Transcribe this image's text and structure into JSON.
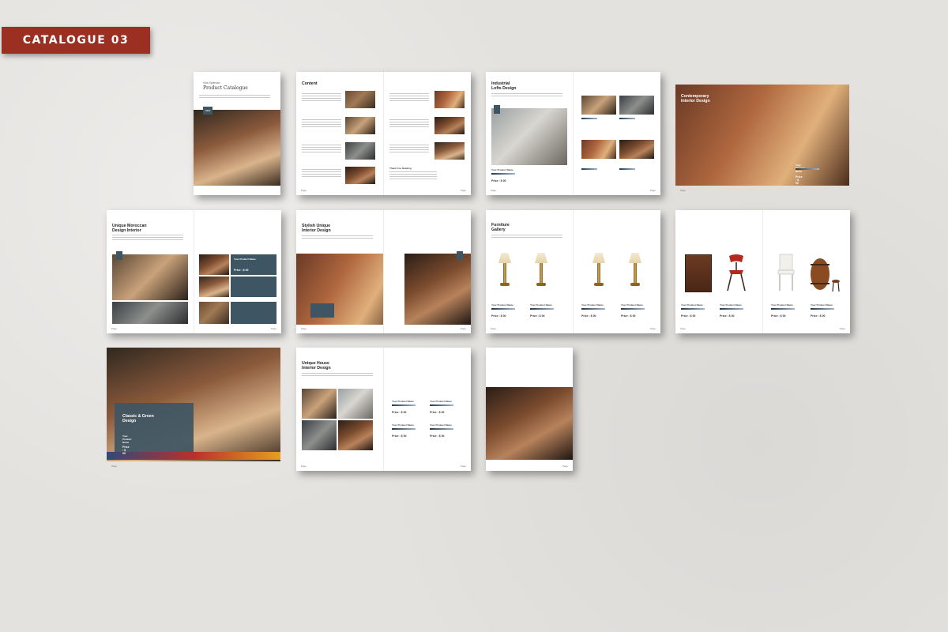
{
  "label": "CATALOGUE 03",
  "cover": {
    "small": "Villa Splendor",
    "title": "Product Catalogue",
    "badge": "NEW"
  },
  "contents": {
    "title": "Content",
    "note": "Thank You Reading"
  },
  "industrial": {
    "title": "Industrial\nLofts Design",
    "product": "Your Product Name",
    "price": "Price : $ 00"
  },
  "contemporary": {
    "title": "Contemporary\nInterior Design",
    "product": "Your Product Name",
    "price": "Price : $ 00"
  },
  "moroccan": {
    "title": "Unique Moroccan\nDesign Interior",
    "product": "Your Product Name",
    "price": "Price : $ 00"
  },
  "stylish": {
    "title": "Stylish Unique\nInterior Design"
  },
  "furniture": {
    "title": "Furniture\nGallery",
    "product": "Your Product Name",
    "price": "Price : $ 00"
  },
  "classic": {
    "title": "Classic & Green\nDesign",
    "product": "Your Product Name",
    "price": "Price : $ 00"
  },
  "unique": {
    "title": "Unique House\nInterior Design",
    "product": "Your Product Name",
    "price": "Price : $ 00"
  },
  "page_label": "Page",
  "colors": {
    "label_bg": "#9b2f22",
    "navy": "#3e5563",
    "paper": "#e4e2df"
  }
}
